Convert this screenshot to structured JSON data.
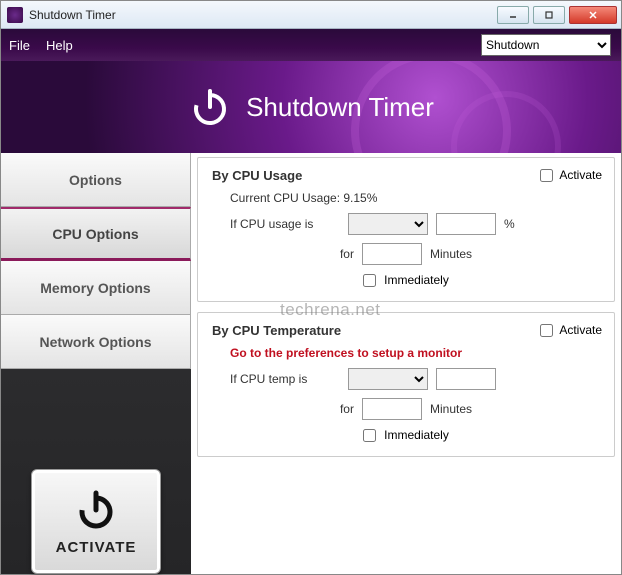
{
  "window": {
    "title": "Shutdown Timer"
  },
  "menu": {
    "file": "File",
    "help": "Help"
  },
  "action_select": {
    "value": "Shutdown"
  },
  "header": {
    "title": "Shutdown Timer"
  },
  "sidebar": {
    "tabs": [
      {
        "label": "Options"
      },
      {
        "label": "CPU Options"
      },
      {
        "label": "Memory Options"
      },
      {
        "label": "Network Options"
      }
    ],
    "activate_label": "ACTIVATE"
  },
  "cpu_usage": {
    "title": "By CPU Usage",
    "activate_label": "Activate",
    "current_label": "Current CPU Usage: 9.15%",
    "if_label": "If CPU usage is",
    "comparator": "",
    "threshold": "",
    "percent": "%",
    "for_label": "for",
    "duration": "",
    "minutes_label": "Minutes",
    "immediately_label": "Immediately"
  },
  "cpu_temp": {
    "title": "By CPU Temperature",
    "activate_label": "Activate",
    "warning": "Go to the preferences to setup a monitor",
    "if_label": "If CPU temp is",
    "comparator": "",
    "threshold": "",
    "for_label": "for",
    "duration": "",
    "minutes_label": "Minutes",
    "immediately_label": "Immediately"
  },
  "watermark": "techrena.net"
}
